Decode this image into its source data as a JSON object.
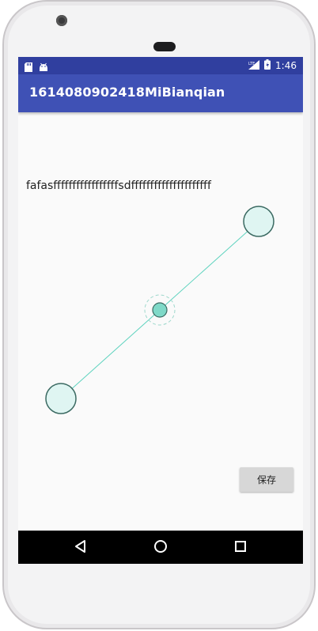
{
  "status_bar": {
    "time": "1:46",
    "network_label": "LTE",
    "icons": [
      "sd-card-icon",
      "android-icon",
      "signal-icon",
      "battery-icon"
    ]
  },
  "app_bar": {
    "title": "1614080902418MiBianqian"
  },
  "content": {
    "note_text": "fafasfffffffffffffffffsdfffffffffffffffffffff",
    "save_label": "保存"
  },
  "navigation": {
    "icons": [
      "back-icon",
      "home-icon",
      "recents-icon"
    ]
  },
  "colors": {
    "status_bar": "#303f9f",
    "app_bar": "#3f51b5",
    "handle_fill": "#dff5f2",
    "handle_stroke": "#3b6a62",
    "center_fill": "#7fd9c8",
    "line": "#5fd3bf"
  }
}
